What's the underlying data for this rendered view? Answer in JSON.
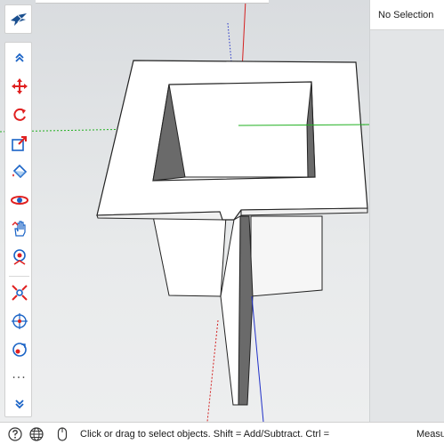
{
  "selection": {
    "label": "No Selection"
  },
  "toolbar": {
    "tools": [
      {
        "name": "collapse-up-icon"
      },
      {
        "name": "move-tool-icon"
      },
      {
        "name": "rotate-tool-icon"
      },
      {
        "name": "scale-tool-icon"
      },
      {
        "name": "paint-bucket-icon"
      },
      {
        "name": "orbit-tool-icon"
      },
      {
        "name": "pan-tool-icon"
      },
      {
        "name": "position-camera-icon"
      },
      {
        "name": "zoom-extents-icon"
      },
      {
        "name": "walk-tool-icon"
      },
      {
        "name": "look-around-icon"
      },
      {
        "name": "more-tools-icon"
      },
      {
        "name": "expand-down-icon"
      }
    ],
    "more_label": "···"
  },
  "statusbar": {
    "hint": "Click or drag to select objects. Shift = Add/Subtract. Ctrl =",
    "measurements_label": "Measurements"
  },
  "colors": {
    "axis_red": "#d42020",
    "axis_green": "#20b020",
    "axis_blue": "#2030c8",
    "face_light": "#ffffff",
    "face_shadow": "#6a6a6a",
    "face_side": "#f2f2f2",
    "accent": "#1a63c6"
  }
}
